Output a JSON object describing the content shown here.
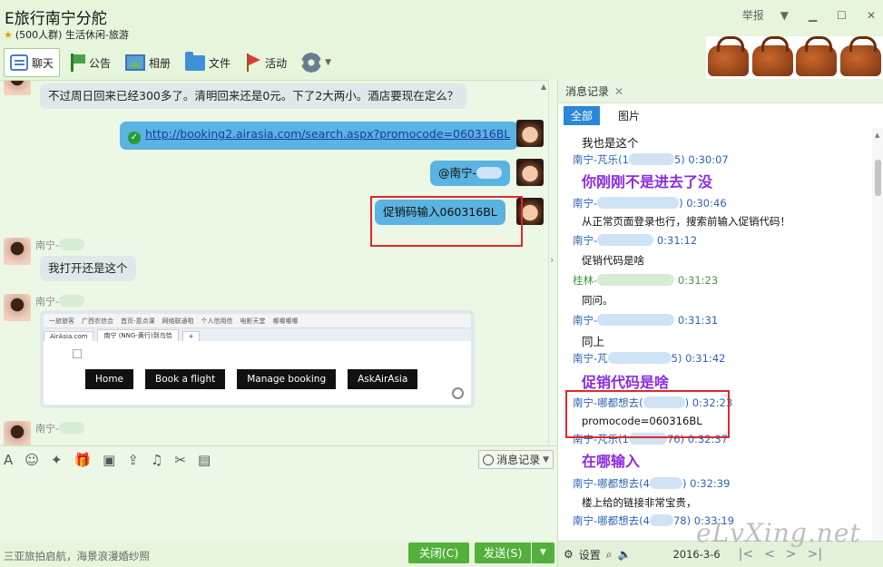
{
  "window": {
    "title": "E旅行南宁分舵",
    "subtitle": "(500人群) 生活休闲-旅游",
    "report": "举报"
  },
  "toolbar": {
    "items": [
      {
        "label": "聊天",
        "icon": "chat-icon"
      },
      {
        "label": "公告",
        "icon": "announcement-icon"
      },
      {
        "label": "相册",
        "icon": "photo-album-icon"
      },
      {
        "label": "文件",
        "icon": "folder-icon"
      },
      {
        "label": "活动",
        "icon": "flag-icon"
      }
    ]
  },
  "chat": {
    "messages": [
      {
        "text": "不过周日回来已经300多了。清明回来还是0元。下了2大两小。酒店要现在定么？"
      },
      {
        "text": "http://booking2.airasia.com/search.aspx?promocode=060316BL"
      },
      {
        "text": "@南宁-"
      },
      {
        "text": "促销码输入060316BL"
      },
      {
        "sender": "南宁-",
        "text": "我打开还是这个"
      },
      {
        "sender": "南宁-"
      },
      {
        "sender": "南宁-"
      }
    ],
    "screenshot": {
      "bookmarks": [
        "一旅旅客",
        "广西农信合",
        "首页-意点课",
        "网络联通啦",
        "个人信用信",
        "电影天堂",
        "哪哪哪哪"
      ],
      "tab1": "AirAsia.com",
      "tab2": "南宁 (NNG-黄行)到乌恰",
      "nav": [
        "Home",
        "Book a flight",
        "Manage booking",
        "AskAirAsia"
      ]
    }
  },
  "input_toolbar": {
    "history_label": "消息记录"
  },
  "bottom": {
    "ad_text": "三亚旅拍启航，海景浪漫婚纱照",
    "close_label": "关闭(C)",
    "send_label": "发送(S)"
  },
  "history": {
    "title": "消息记录",
    "tab_all": "全部",
    "tab_pictures": "图片",
    "entries": [
      {
        "kind": "msg",
        "text": "我也是这个"
      },
      {
        "kind": "hdr",
        "name": "南宁-芃乐(1",
        "time": "5) 0:30:07"
      },
      {
        "kind": "big",
        "text": "你刚刚不是进去了没"
      },
      {
        "kind": "hdr",
        "name": "南宁-",
        "time": ") 0:30:46"
      },
      {
        "kind": "msg",
        "text": "从正常页面登录也行，搜索前输入促销代码！"
      },
      {
        "kind": "hdr",
        "name": "南宁-",
        "time": "0:31:12"
      },
      {
        "kind": "msg",
        "text": "促销代码是啥"
      },
      {
        "kind": "hdr",
        "name": "桂林-",
        "time": "0:31:23"
      },
      {
        "kind": "msg",
        "text": "同问。"
      },
      {
        "kind": "hdr",
        "name": "南宁-",
        "time": "0:31:31"
      },
      {
        "kind": "msg",
        "text": "同上"
      },
      {
        "kind": "hdr",
        "name": "南宁-芃",
        "time": "5) 0:31:42"
      },
      {
        "kind": "big",
        "text": "促销代码是啥"
      },
      {
        "kind": "hdr",
        "name": "南宁-哪都想去(",
        "time": "0:32:23"
      },
      {
        "kind": "msg",
        "text": "promocode=060316BL"
      },
      {
        "kind": "hdr",
        "name": "南宁-芃乐(1",
        "time": "76) 0:32:37"
      },
      {
        "kind": "big",
        "text": "在哪输入"
      },
      {
        "kind": "hdr",
        "name": "南宁-哪都想去(4",
        "time": ") 0:32:39"
      },
      {
        "kind": "msg",
        "text": "楼上给的链接非常宝贵，"
      },
      {
        "kind": "hdr",
        "name": "南宁-哪都想去(4",
        "time": "78) 0:33:19"
      }
    ],
    "settings_label": "设置",
    "date": "2016-3-6"
  },
  "watermark": "eLvXing.net",
  "colors": {
    "accent": "#53b03a",
    "bubble_self": "#5ab3e0",
    "bubble_other": "#dfe8ea",
    "highlight_text": "#8b2be2",
    "red_box": "#e0282a"
  }
}
